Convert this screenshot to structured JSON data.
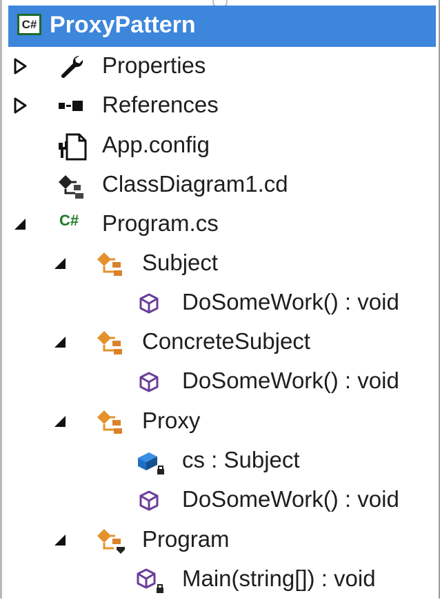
{
  "project": {
    "badge": "C#",
    "title": "ProxyPattern"
  },
  "tree": {
    "properties": "Properties",
    "references": "References",
    "app_config": "App.config",
    "class_diagram": "ClassDiagram1.cd",
    "program_cs": {
      "badge": "C#",
      "label": "Program.cs"
    },
    "subject": {
      "label": "Subject",
      "method": "DoSomeWork() : void"
    },
    "concrete_subject": {
      "label": "ConcreteSubject",
      "method": "DoSomeWork() : void"
    },
    "proxy": {
      "label": "Proxy",
      "field": "cs : Subject",
      "method": "DoSomeWork() : void"
    },
    "program": {
      "label": "Program",
      "method": "Main(string[]) : void"
    }
  },
  "colors": {
    "selection": "#3c86db",
    "class_icon": "#e5912b",
    "method_icon": "#6a3d9a",
    "field_icon": "#1f6fc4",
    "csharp": "#1b7a25"
  }
}
